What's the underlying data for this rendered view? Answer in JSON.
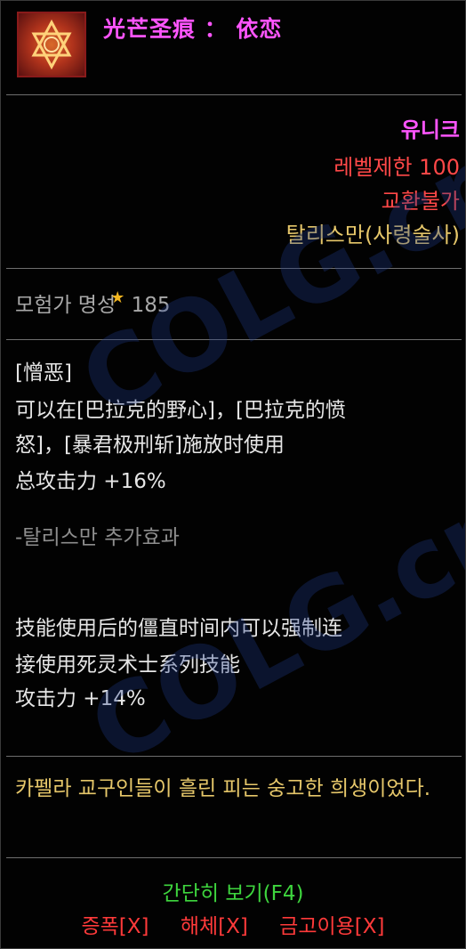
{
  "item": {
    "name": "光芒圣痕 ： 依恋",
    "rarity": "유니크",
    "level_req": "레벨제한 100",
    "trade": "교환불가",
    "type": "탈리스만(사령술사)"
  },
  "fame": {
    "label": "모험가 명성",
    "value": "185"
  },
  "skill": {
    "name": "[憎恶]",
    "line1": "可以在[巴拉克的野心]，[巴拉克的愤",
    "line2": "怒]，[暴君极刑斩]施放时使用",
    "line3": "总攻击力 +16%"
  },
  "talisman": {
    "header": "-탈리스만 추가효과",
    "line1": "技能使用后的僵直时间内可以强制连",
    "line2": "接使用死灵术士系列技能",
    "line3": "攻击力 +14%"
  },
  "lore": "카펠라 교구인들이 흘린 피는 숭고한 희생이었다.",
  "footer": {
    "simple_view": "간단히 보기(F4)",
    "register": "증폭[X]",
    "disassemble": "해체[X]",
    "storage": "금고이용[X]"
  },
  "watermark": "COLG.cn"
}
